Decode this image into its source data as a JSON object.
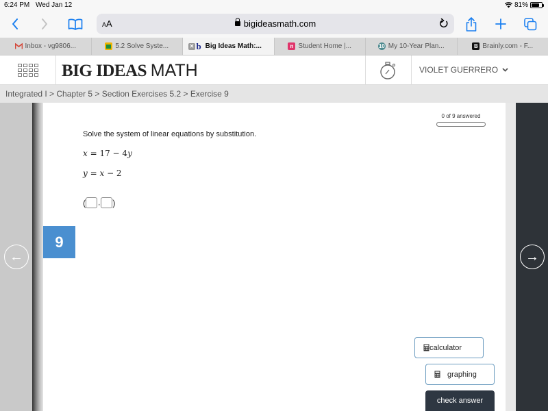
{
  "status_bar": {
    "time": "6:24 PM",
    "date": "Wed Jan 12",
    "battery_percent": "81%",
    "battery_level": 0.81
  },
  "browser": {
    "text_size_label": "AA",
    "url": "bigideasmath.com",
    "icons": [
      "back-icon",
      "forward-icon",
      "bookmarks-icon",
      "lock-icon",
      "reload-icon",
      "share-icon",
      "new-tab-icon",
      "tabs-overview-icon"
    ]
  },
  "tabs": [
    {
      "label": "Inbox - vg9806...",
      "favicon": "gmail-icon",
      "active": false
    },
    {
      "label": "5.2 Solve Syste...",
      "favicon": "google-classroom-icon",
      "active": false
    },
    {
      "label": "Big Ideas Math:...",
      "favicon": "big-ideas-icon",
      "active": true
    },
    {
      "label": "Student Home |...",
      "favicon": "naviance-icon",
      "active": false
    },
    {
      "label": "My 10-Year Plan...",
      "favicon": "plan-icon",
      "active": false
    },
    {
      "label": "Brainly.com - F...",
      "favicon": "brainly-icon",
      "active": false
    }
  ],
  "header": {
    "logo_bold": "BIG IDEAS",
    "logo_thin": "MATH",
    "user_name": "VIOLET GUERRERO"
  },
  "breadcrumb": "Integrated I > Chapter 5 > Section Exercises 5.2 > Exercise 9",
  "progress": {
    "label": "0 of 9 answered",
    "answered": 0,
    "total": 9
  },
  "question": {
    "number": "9",
    "prompt": "Solve the system of linear equations by substitution.",
    "equations": [
      "x = 17 − 4y",
      "y = x − 2"
    ],
    "answer_format": "( □ , □ )",
    "answer_values": [
      "",
      ""
    ]
  },
  "tools": {
    "calculator_label": "calculator",
    "graphing_label": "graphing",
    "check_answer_label": "check answer"
  },
  "colors": {
    "accent_blue": "#4a8fd0",
    "ios_blue": "#1a7ff0",
    "dark_panel": "#2e3338",
    "check_button": "#2e3742"
  }
}
